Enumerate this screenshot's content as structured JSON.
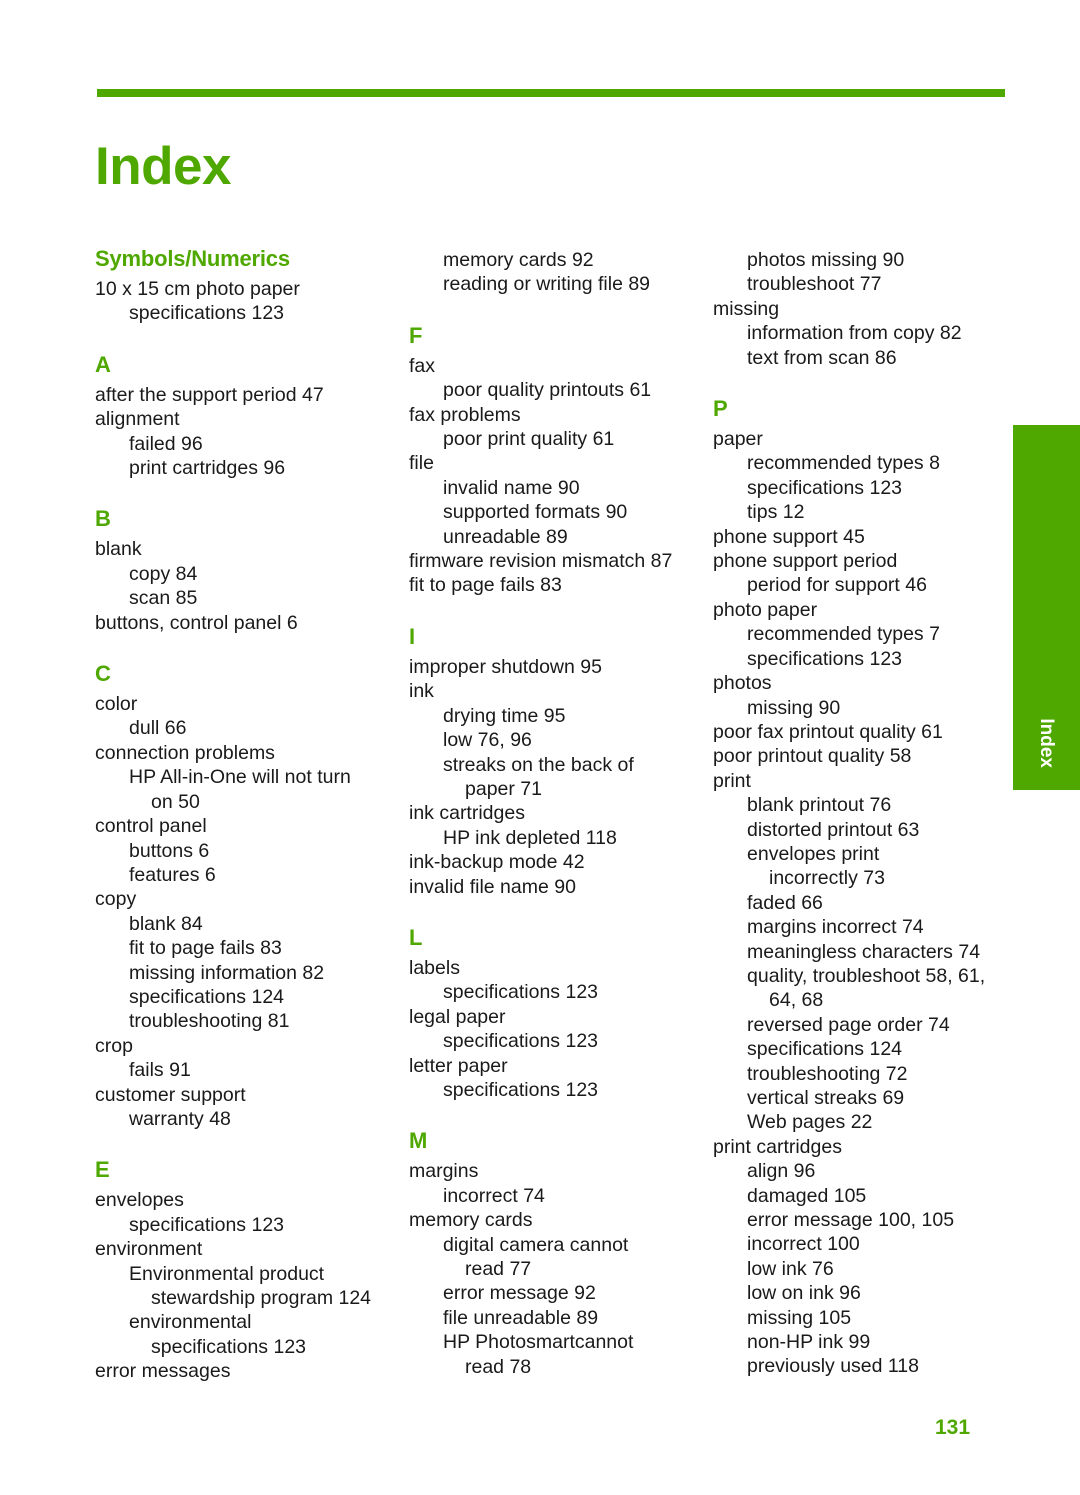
{
  "document": {
    "title": "Index",
    "page_number": "131",
    "side_tab_label": "Index",
    "accent_color": "#4FA800",
    "text_color": "#1a1a1a"
  },
  "columns": [
    {
      "name": "column-1",
      "sections": [
        {
          "letter": "Symbols/Numerics",
          "is_symbols": true,
          "entries": [
            {
              "level": 0,
              "text": "10 x 15 cm photo paper"
            },
            {
              "level": 1,
              "text": "specifications 123"
            }
          ]
        },
        {
          "letter": "A",
          "entries": [
            {
              "level": 0,
              "text": "after the support period 47"
            },
            {
              "level": 0,
              "text": "alignment"
            },
            {
              "level": 1,
              "text": "failed 96"
            },
            {
              "level": 1,
              "text": "print cartridges 96"
            }
          ]
        },
        {
          "letter": "B",
          "entries": [
            {
              "level": 0,
              "text": "blank"
            },
            {
              "level": 1,
              "text": "copy 84"
            },
            {
              "level": 1,
              "text": "scan 85"
            },
            {
              "level": 0,
              "text": "buttons, control panel 6"
            }
          ]
        },
        {
          "letter": "C",
          "entries": [
            {
              "level": 0,
              "text": "color"
            },
            {
              "level": 1,
              "text": "dull 66"
            },
            {
              "level": 0,
              "text": "connection problems"
            },
            {
              "level": 1,
              "text": "HP All-in-One will not turn"
            },
            {
              "level": 2,
              "text": "on 50"
            },
            {
              "level": 0,
              "text": "control panel"
            },
            {
              "level": 1,
              "text": "buttons 6"
            },
            {
              "level": 1,
              "text": "features 6"
            },
            {
              "level": 0,
              "text": "copy"
            },
            {
              "level": 1,
              "text": "blank 84"
            },
            {
              "level": 1,
              "text": "fit to page fails 83"
            },
            {
              "level": 1,
              "text": "missing information 82"
            },
            {
              "level": 1,
              "text": "specifications 124"
            },
            {
              "level": 1,
              "text": "troubleshooting 81"
            },
            {
              "level": 0,
              "text": "crop"
            },
            {
              "level": 1,
              "text": "fails 91"
            },
            {
              "level": 0,
              "text": "customer support"
            },
            {
              "level": 1,
              "text": "warranty 48"
            }
          ]
        },
        {
          "letter": "E",
          "entries": [
            {
              "level": 0,
              "text": "envelopes"
            },
            {
              "level": 1,
              "text": "specifications 123"
            },
            {
              "level": 0,
              "text": "environment"
            },
            {
              "level": 1,
              "text": "Environmental product"
            },
            {
              "level": 2,
              "text": "stewardship program 124"
            },
            {
              "level": 1,
              "text": "environmental"
            },
            {
              "level": 2,
              "text": "specifications 123"
            },
            {
              "level": 0,
              "text": "error messages"
            }
          ]
        }
      ]
    },
    {
      "name": "column-2",
      "sections": [
        {
          "letter": "",
          "continued": true,
          "entries": [
            {
              "level": 1,
              "text": "memory cards 92"
            },
            {
              "level": 1,
              "text": "reading or writing file 89"
            }
          ]
        },
        {
          "letter": "F",
          "entries": [
            {
              "level": 0,
              "text": "fax"
            },
            {
              "level": 1,
              "text": "poor quality printouts 61"
            },
            {
              "level": 0,
              "text": "fax problems"
            },
            {
              "level": 1,
              "text": "poor print quality 61"
            },
            {
              "level": 0,
              "text": "file"
            },
            {
              "level": 1,
              "text": "invalid name 90"
            },
            {
              "level": 1,
              "text": "supported formats 90"
            },
            {
              "level": 1,
              "text": "unreadable 89"
            },
            {
              "level": 0,
              "text": "firmware revision mismatch 87"
            },
            {
              "level": 0,
              "text": "fit to page fails 83"
            }
          ]
        },
        {
          "letter": "I",
          "entries": [
            {
              "level": 0,
              "text": "improper shutdown 95"
            },
            {
              "level": 0,
              "text": "ink"
            },
            {
              "level": 1,
              "text": "drying time 95"
            },
            {
              "level": 1,
              "text": "low 76, 96"
            },
            {
              "level": 1,
              "text": "streaks on the back of"
            },
            {
              "level": 2,
              "text": "paper 71"
            },
            {
              "level": 0,
              "text": "ink cartridges"
            },
            {
              "level": 1,
              "text": "HP ink depleted 118"
            },
            {
              "level": 0,
              "text": "ink-backup mode 42"
            },
            {
              "level": 0,
              "text": "invalid file name 90"
            }
          ]
        },
        {
          "letter": "L",
          "entries": [
            {
              "level": 0,
              "text": "labels"
            },
            {
              "level": 1,
              "text": "specifications 123"
            },
            {
              "level": 0,
              "text": "legal paper"
            },
            {
              "level": 1,
              "text": "specifications 123"
            },
            {
              "level": 0,
              "text": "letter paper"
            },
            {
              "level": 1,
              "text": "specifications 123"
            }
          ]
        },
        {
          "letter": "M",
          "entries": [
            {
              "level": 0,
              "text": "margins"
            },
            {
              "level": 1,
              "text": "incorrect 74"
            },
            {
              "level": 0,
              "text": "memory cards"
            },
            {
              "level": 1,
              "text": "digital camera cannot"
            },
            {
              "level": 2,
              "text": "read 77"
            },
            {
              "level": 1,
              "text": "error message 92"
            },
            {
              "level": 1,
              "text": "file unreadable 89"
            },
            {
              "level": 1,
              "text": "HP Photosmartcannot"
            },
            {
              "level": 2,
              "text": "read 78"
            }
          ]
        }
      ]
    },
    {
      "name": "column-3",
      "sections": [
        {
          "letter": "",
          "continued": true,
          "entries": [
            {
              "level": 1,
              "text": "photos missing 90"
            },
            {
              "level": 1,
              "text": "troubleshoot 77"
            },
            {
              "level": 0,
              "text": "missing"
            },
            {
              "level": 1,
              "text": "information from copy 82"
            },
            {
              "level": 1,
              "text": "text from scan 86"
            }
          ]
        },
        {
          "letter": "P",
          "entries": [
            {
              "level": 0,
              "text": "paper"
            },
            {
              "level": 1,
              "text": "recommended types 8"
            },
            {
              "level": 1,
              "text": "specifications 123"
            },
            {
              "level": 1,
              "text": "tips 12"
            },
            {
              "level": 0,
              "text": "phone support 45"
            },
            {
              "level": 0,
              "text": "phone support period"
            },
            {
              "level": 1,
              "text": "period for support 46"
            },
            {
              "level": 0,
              "text": "photo paper"
            },
            {
              "level": 1,
              "text": "recommended types 7"
            },
            {
              "level": 1,
              "text": "specifications 123"
            },
            {
              "level": 0,
              "text": "photos"
            },
            {
              "level": 1,
              "text": "missing 90"
            },
            {
              "level": 0,
              "text": "poor fax printout quality 61"
            },
            {
              "level": 0,
              "text": "poor printout quality 58"
            },
            {
              "level": 0,
              "text": "print"
            },
            {
              "level": 1,
              "text": "blank printout 76"
            },
            {
              "level": 1,
              "text": "distorted printout 63"
            },
            {
              "level": 1,
              "text": "envelopes print"
            },
            {
              "level": 2,
              "text": "incorrectly 73"
            },
            {
              "level": 1,
              "text": "faded 66"
            },
            {
              "level": 1,
              "text": "margins incorrect 74"
            },
            {
              "level": 1,
              "text": "meaningless characters 74"
            },
            {
              "level": 1,
              "text": "quality, troubleshoot 58, 61,"
            },
            {
              "level": 2,
              "text": "64, 68"
            },
            {
              "level": 1,
              "text": "reversed page order 74"
            },
            {
              "level": 1,
              "text": "specifications 124"
            },
            {
              "level": 1,
              "text": "troubleshooting 72"
            },
            {
              "level": 1,
              "text": "vertical streaks 69"
            },
            {
              "level": 1,
              "text": "Web pages 22"
            },
            {
              "level": 0,
              "text": "print cartridges"
            },
            {
              "level": 1,
              "text": "align 96"
            },
            {
              "level": 1,
              "text": "damaged 105"
            },
            {
              "level": 1,
              "text": "error message 100, 105"
            },
            {
              "level": 1,
              "text": "incorrect 100"
            },
            {
              "level": 1,
              "text": "low ink 76"
            },
            {
              "level": 1,
              "text": "low on ink 96"
            },
            {
              "level": 1,
              "text": "missing 105"
            },
            {
              "level": 1,
              "text": "non-HP ink 99"
            },
            {
              "level": 1,
              "text": "previously used 118"
            }
          ]
        }
      ]
    }
  ]
}
